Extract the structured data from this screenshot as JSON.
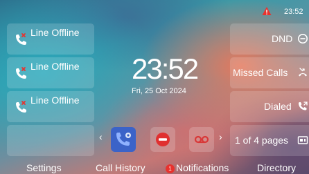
{
  "status": {
    "time": "23:52"
  },
  "clock": {
    "time": "23:52",
    "date": "Fri, 25 Oct 2024"
  },
  "lines": [
    {
      "label": "Line Offline"
    },
    {
      "label": "Line Offline"
    },
    {
      "label": "Line Offline"
    }
  ],
  "right_keys": {
    "dnd": "DND",
    "missed_calls": "Missed Calls",
    "dialed": "Dialed",
    "pages": "1 of 4 pages"
  },
  "bottom_nav": {
    "settings": "Settings",
    "call_history": "Call History",
    "notifications": "Notifications",
    "notifications_badge": "1",
    "directory": "Directory"
  },
  "colors": {
    "warning": "#e8322e",
    "dock_settings": "#3b63c8",
    "dock_dnd": "#e03030",
    "dock_voicemail": "#d83838",
    "offline_x": "#e8322e"
  }
}
